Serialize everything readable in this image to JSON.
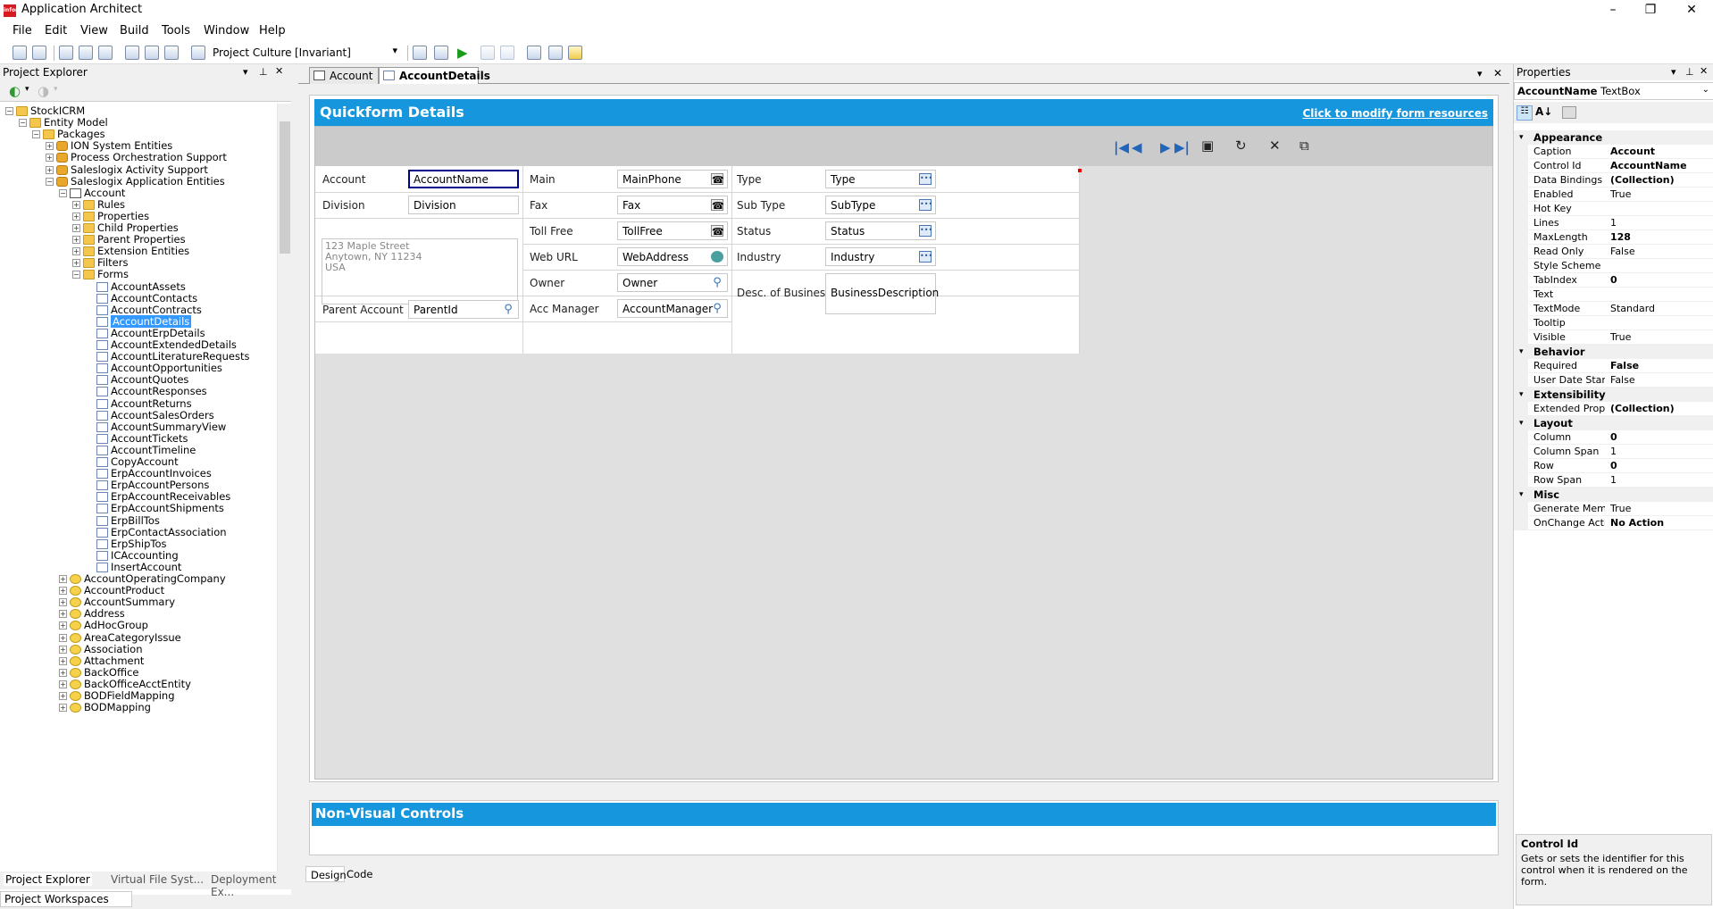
{
  "app": {
    "title": "Application Architect",
    "logo": "infor"
  },
  "menu": [
    "File",
    "Edit",
    "View",
    "Build",
    "Tools",
    "Window",
    "Help"
  ],
  "toolbar": {
    "culture_label": "Project Culture:",
    "culture_value": "[Invariant]"
  },
  "project_explorer": {
    "title": "Project Explorer",
    "tree": [
      {
        "label": "StockICRM",
        "level": 0,
        "icon": "folder-icon",
        "exp": "-"
      },
      {
        "label": "Entity Model",
        "level": 1,
        "icon": "folder-icon",
        "exp": "-"
      },
      {
        "label": "Packages",
        "level": 2,
        "icon": "folder-icon",
        "exp": "-"
      },
      {
        "label": "ION System Entities",
        "level": 3,
        "icon": "database-icon",
        "exp": "+"
      },
      {
        "label": "Process Orchestration Support",
        "level": 3,
        "icon": "database-icon",
        "exp": "+"
      },
      {
        "label": "Saleslogix Activity Support",
        "level": 3,
        "icon": "database-icon",
        "exp": "+"
      },
      {
        "label": "Saleslogix Application Entities",
        "level": 3,
        "icon": "database-icon",
        "exp": "-"
      },
      {
        "label": "Account",
        "level": 4,
        "icon": "entity-icon",
        "exp": "-"
      },
      {
        "label": "Rules",
        "level": 5,
        "icon": "folder-icon",
        "exp": "+"
      },
      {
        "label": "Properties",
        "level": 5,
        "icon": "folder-icon",
        "exp": "+"
      },
      {
        "label": "Child Properties",
        "level": 5,
        "icon": "folder-icon",
        "exp": "+"
      },
      {
        "label": "Parent Properties",
        "level": 5,
        "icon": "folder-icon",
        "exp": "+"
      },
      {
        "label": "Extension Entities",
        "level": 5,
        "icon": "folder-icon",
        "exp": "+"
      },
      {
        "label": "Filters",
        "level": 5,
        "icon": "folder-icon",
        "exp": "+"
      },
      {
        "label": "Forms",
        "level": 5,
        "icon": "folder-icon",
        "exp": "-"
      },
      {
        "label": "AccountAssets",
        "level": 6,
        "icon": "form-icon",
        "exp": ""
      },
      {
        "label": "AccountContacts",
        "level": 6,
        "icon": "form-icon",
        "exp": ""
      },
      {
        "label": "AccountContracts",
        "level": 6,
        "icon": "form-icon",
        "exp": ""
      },
      {
        "label": "AccountDetails",
        "level": 6,
        "icon": "form-icon",
        "exp": "",
        "selected": true
      },
      {
        "label": "AccountErpDetails",
        "level": 6,
        "icon": "form-icon",
        "exp": ""
      },
      {
        "label": "AccountExtendedDetails",
        "level": 6,
        "icon": "form-icon",
        "exp": ""
      },
      {
        "label": "AccountLiteratureRequests",
        "level": 6,
        "icon": "form-icon",
        "exp": ""
      },
      {
        "label": "AccountOpportunities",
        "level": 6,
        "icon": "form-icon",
        "exp": ""
      },
      {
        "label": "AccountQuotes",
        "level": 6,
        "icon": "form-icon",
        "exp": ""
      },
      {
        "label": "AccountResponses",
        "level": 6,
        "icon": "form-icon",
        "exp": ""
      },
      {
        "label": "AccountReturns",
        "level": 6,
        "icon": "form-icon",
        "exp": ""
      },
      {
        "label": "AccountSalesOrders",
        "level": 6,
        "icon": "form-icon",
        "exp": ""
      },
      {
        "label": "AccountSummaryView",
        "level": 6,
        "icon": "form-icon",
        "exp": ""
      },
      {
        "label": "AccountTickets",
        "level": 6,
        "icon": "form-icon",
        "exp": ""
      },
      {
        "label": "AccountTimeline",
        "level": 6,
        "icon": "form-icon",
        "exp": ""
      },
      {
        "label": "CopyAccount",
        "level": 6,
        "icon": "form-icon",
        "exp": ""
      },
      {
        "label": "ErpAccountInvoices",
        "level": 6,
        "icon": "form-icon",
        "exp": ""
      },
      {
        "label": "ErpAccountPersons",
        "level": 6,
        "icon": "form-icon",
        "exp": ""
      },
      {
        "label": "ErpAccountReceivables",
        "level": 6,
        "icon": "form-icon",
        "exp": ""
      },
      {
        "label": "ErpAccountShipments",
        "level": 6,
        "icon": "form-icon",
        "exp": ""
      },
      {
        "label": "ErpBillTos",
        "level": 6,
        "icon": "form-icon",
        "exp": ""
      },
      {
        "label": "ErpContactAssociation",
        "level": 6,
        "icon": "form-icon",
        "exp": ""
      },
      {
        "label": "ErpShipTos",
        "level": 6,
        "icon": "form-icon",
        "exp": ""
      },
      {
        "label": "ICAccounting",
        "level": 6,
        "icon": "form-icon",
        "exp": ""
      },
      {
        "label": "InsertAccount",
        "level": 6,
        "icon": "form-icon",
        "exp": ""
      },
      {
        "label": "AccountOperatingCompany",
        "level": 4,
        "icon": "entity-gear-icon",
        "exp": "+"
      },
      {
        "label": "AccountProduct",
        "level": 4,
        "icon": "entity-gear-icon",
        "exp": "+"
      },
      {
        "label": "AccountSummary",
        "level": 4,
        "icon": "entity-gear-icon",
        "exp": "+"
      },
      {
        "label": "Address",
        "level": 4,
        "icon": "entity-gear-icon",
        "exp": "+"
      },
      {
        "label": "AdHocGroup",
        "level": 4,
        "icon": "entity-gear-icon",
        "exp": "+"
      },
      {
        "label": "AreaCategoryIssue",
        "level": 4,
        "icon": "entity-gear-icon",
        "exp": "+"
      },
      {
        "label": "Association",
        "level": 4,
        "icon": "entity-gear-icon",
        "exp": "+"
      },
      {
        "label": "Attachment",
        "level": 4,
        "icon": "entity-gear-icon",
        "exp": "+"
      },
      {
        "label": "BackOffice",
        "level": 4,
        "icon": "entity-gear-icon",
        "exp": "+"
      },
      {
        "label": "BackOfficeAcctEntity",
        "level": 4,
        "icon": "entity-gear-icon",
        "exp": "+"
      },
      {
        "label": "BODFieldMapping",
        "level": 4,
        "icon": "entity-gear-icon",
        "exp": "+"
      },
      {
        "label": "BODMapping",
        "level": 4,
        "icon": "entity-gear-icon",
        "exp": "+"
      }
    ],
    "bottom_tabs": [
      "Project Explorer",
      "Virtual File Syst...",
      "Deployment Ex..."
    ],
    "workspace_tab": "Project Workspaces"
  },
  "doc_tabs": [
    {
      "label": "Account",
      "active": false
    },
    {
      "label": "AccountDetails",
      "active": true
    }
  ],
  "quickform": {
    "title": "Quickform Details",
    "link": "Click to modify form resources",
    "address": [
      "123 Maple Street",
      "Anytown, NY 11234",
      "USA"
    ],
    "col1": [
      {
        "label": "Account",
        "value": "AccountName",
        "focus": true
      },
      {
        "label": "Division",
        "value": "Division"
      },
      {
        "label": "Parent Account",
        "value": "ParentId",
        "icon": "search-icon"
      }
    ],
    "col2": [
      {
        "label": "Main",
        "value": "MainPhone",
        "icon": "phone-icon"
      },
      {
        "label": "Fax",
        "value": "Fax",
        "icon": "phone-icon"
      },
      {
        "label": "Toll Free",
        "value": "TollFree",
        "icon": "phone-icon"
      },
      {
        "label": "Web URL",
        "value": "WebAddress",
        "icon": "globe-icon"
      },
      {
        "label": "Owner",
        "value": "Owner",
        "icon": "search-icon"
      },
      {
        "label": "Acc Manager",
        "value": "AccountManager",
        "icon": "search-icon"
      }
    ],
    "col3": [
      {
        "label": "Type",
        "value": "Type",
        "icon": "ellipsis-icon"
      },
      {
        "label": "Sub Type",
        "value": "SubType",
        "icon": "ellipsis-icon"
      },
      {
        "label": "Status",
        "value": "Status",
        "icon": "ellipsis-icon"
      },
      {
        "label": "Industry",
        "value": "Industry",
        "icon": "ellipsis-icon"
      },
      {
        "label": "Desc. of Business",
        "value": "BusinessDescription"
      }
    ],
    "nvc_title": "Non-Visual Controls"
  },
  "design_tabs": [
    "Design",
    "Code"
  ],
  "properties": {
    "title": "Properties",
    "object_name": "AccountName",
    "object_type": "TextBox",
    "categories": [
      {
        "name": "Appearance",
        "rows": [
          {
            "name": "Caption",
            "value": "Account",
            "bold": true
          },
          {
            "name": "Control Id",
            "value": "AccountName",
            "bold": true
          },
          {
            "name": "Data Bindings",
            "value": "(Collection)",
            "bold": true
          },
          {
            "name": "Enabled",
            "value": "True"
          },
          {
            "name": "Hot Key",
            "value": ""
          },
          {
            "name": "Lines",
            "value": "1"
          },
          {
            "name": "MaxLength",
            "value": "128",
            "bold": true
          },
          {
            "name": "Read Only",
            "value": "False"
          },
          {
            "name": "Style Scheme",
            "value": ""
          },
          {
            "name": "TabIndex",
            "value": "0",
            "bold": true
          },
          {
            "name": "Text",
            "value": ""
          },
          {
            "name": "TextMode",
            "value": "Standard"
          },
          {
            "name": "Tooltip",
            "value": ""
          },
          {
            "name": "Visible",
            "value": "True"
          }
        ]
      },
      {
        "name": "Behavior",
        "rows": [
          {
            "name": "Required",
            "value": "False",
            "bold": true
          },
          {
            "name": "User Date Stam",
            "value": "False"
          }
        ]
      },
      {
        "name": "Extensibility",
        "rows": [
          {
            "name": "Extended Prope",
            "value": "(Collection)",
            "bold": true
          }
        ]
      },
      {
        "name": "Layout",
        "rows": [
          {
            "name": "Column",
            "value": "0",
            "bold": true
          },
          {
            "name": "Column Span",
            "value": "1"
          },
          {
            "name": "Row",
            "value": "0",
            "bold": true
          },
          {
            "name": "Row Span",
            "value": "1"
          }
        ]
      },
      {
        "name": "Misc",
        "rows": [
          {
            "name": "Generate Memb",
            "value": "True"
          },
          {
            "name": "OnChange Actic",
            "value": "No Action",
            "bold": true
          }
        ]
      }
    ],
    "desc_title": "Control Id",
    "desc_text": "Gets or sets the identifier for this control when it is rendered on the form."
  },
  "colors": {
    "accent": "#1596dd",
    "selection": "#3399ff",
    "focus_border": "#00008b"
  }
}
